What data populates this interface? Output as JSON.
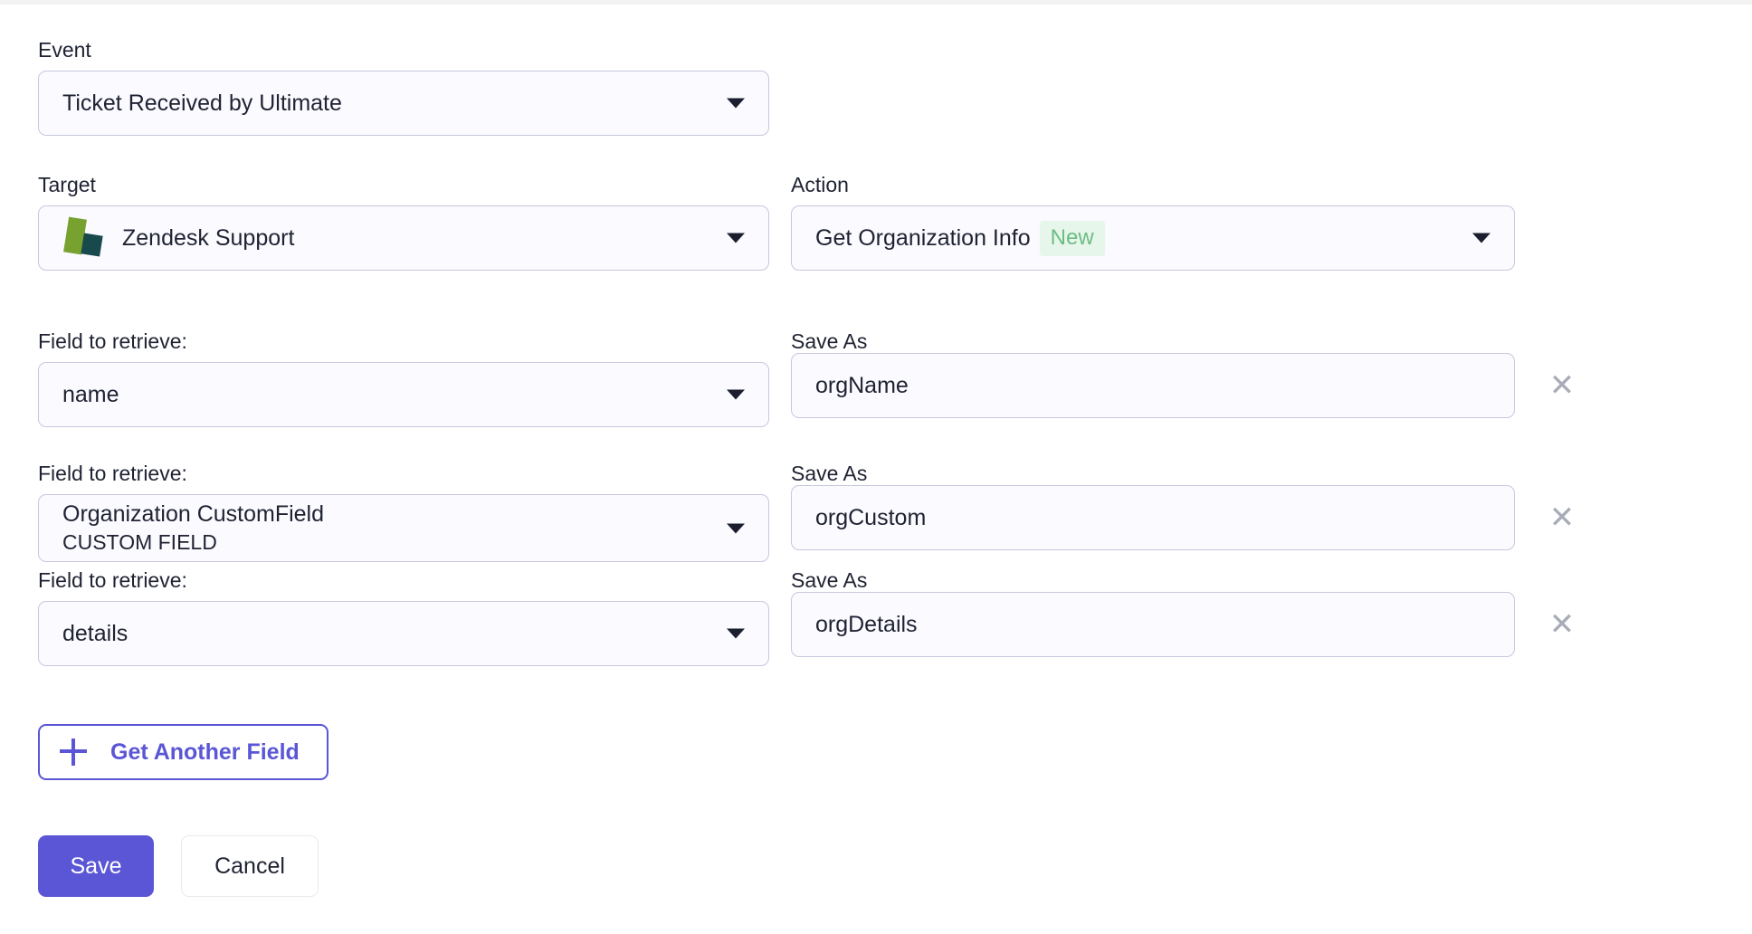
{
  "form": {
    "event": {
      "label": "Event",
      "value": "Ticket Received by Ultimate"
    },
    "target": {
      "label": "Target",
      "value": "Zendesk Support",
      "icon": "zendesk-logo-icon"
    },
    "action": {
      "label": "Action",
      "value": "Get Organization Info",
      "badge": "New"
    },
    "field_rows": [
      {
        "field_label": "Field to retrieve:",
        "field_value": "name",
        "field_subvalue": "",
        "save_label": "Save As",
        "save_value": "orgName",
        "remove_icon": "close-icon"
      },
      {
        "field_label": "Field to retrieve:",
        "field_value": "Organization CustomField",
        "field_subvalue": "CUSTOM FIELD",
        "save_label": "Save As",
        "save_value": "orgCustom",
        "remove_icon": "close-icon"
      },
      {
        "field_label": "Field to retrieve:",
        "field_value": "details",
        "field_subvalue": "",
        "save_label": "Save As",
        "save_value": "orgDetails",
        "remove_icon": "close-icon"
      }
    ],
    "add_field_button": {
      "label": "Get Another Field",
      "icon": "plus-icon"
    },
    "save_button": "Save",
    "cancel_button": "Cancel"
  },
  "colors": {
    "accent": "#5a56d6",
    "badge_bg": "#e7f6ea",
    "badge_text": "#6cbd85",
    "field_bg": "#fafaff",
    "field_border": "#c6c8de",
    "zendesk_green": "#78a22f",
    "zendesk_dark": "#17494d"
  }
}
